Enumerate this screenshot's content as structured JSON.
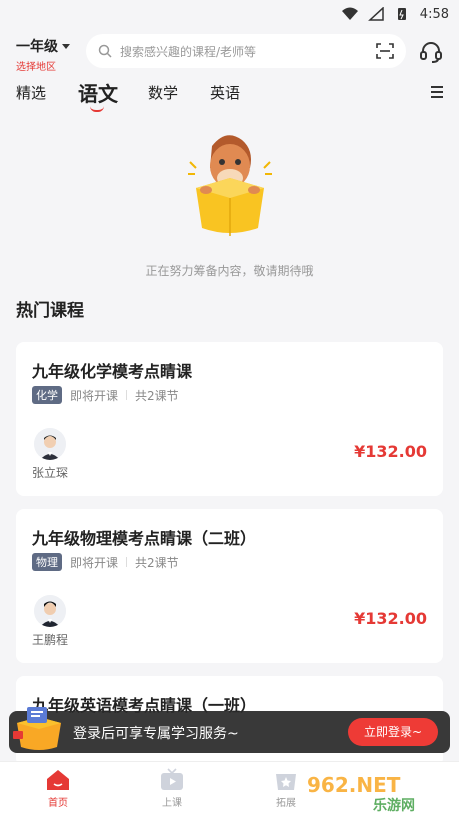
{
  "status_bar": {
    "time": "4:58"
  },
  "header": {
    "grade": "一年级",
    "region": "选择地区",
    "search_placeholder": "搜索感兴趣的课程/老师等"
  },
  "tabs": [
    {
      "label": "精选"
    },
    {
      "label": "语文"
    },
    {
      "label": "数学"
    },
    {
      "label": "英语"
    }
  ],
  "empty_state": {
    "message": "正在努力筹备内容，敬请期待哦"
  },
  "section_title": "热门课程",
  "courses": [
    {
      "title": "九年级化学模考点睛课",
      "subject": "化学",
      "status": "即将开课",
      "lessons": "共2课节",
      "teacher": "张立琛",
      "price": "¥132.00"
    },
    {
      "title": "九年级物理模考点睛课（二班）",
      "subject": "物理",
      "status": "即将开课",
      "lessons": "共2课节",
      "teacher": "王鹏程",
      "price": "¥132.00"
    },
    {
      "title": "九年级英语模考点睛课（一班）"
    }
  ],
  "login_banner": {
    "text": "登录后可享专属学习服务~",
    "button": "立即登录~"
  },
  "bottom_nav": [
    {
      "label": "首页",
      "icon": "home-icon"
    },
    {
      "label": "上课",
      "icon": "tv-icon"
    },
    {
      "label": "拓展",
      "icon": "star-bag-icon"
    }
  ],
  "watermark": {
    "text": "962.NET 乐游网"
  },
  "colors": {
    "accent": "#e53935",
    "tag": "#5f6b84",
    "background": "#f5f5f7"
  }
}
